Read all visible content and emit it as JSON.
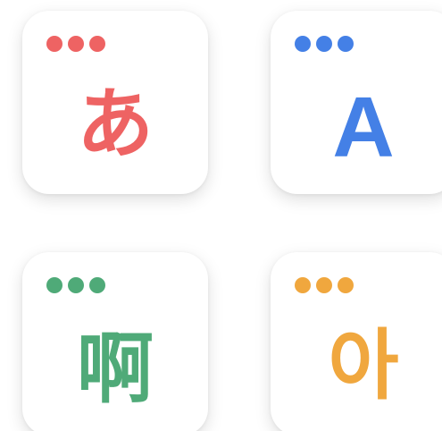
{
  "cards": [
    {
      "glyph": "あ",
      "color": "#EE6363",
      "icon": "window-dots-icon"
    },
    {
      "glyph": "A",
      "color": "#4480E6",
      "icon": "window-dots-icon"
    },
    {
      "glyph": "啊",
      "color": "#4FAA78",
      "icon": "window-dots-icon"
    },
    {
      "glyph": "아",
      "color": "#F0A73E",
      "icon": "window-dots-icon"
    }
  ]
}
